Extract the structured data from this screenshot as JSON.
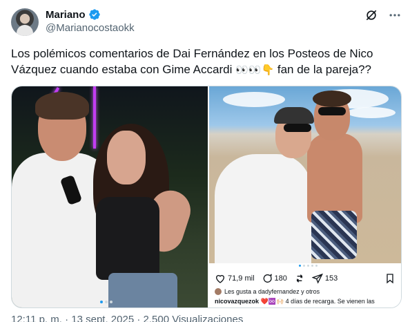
{
  "author": {
    "name": "Mariano",
    "handle": "@Marianocostaokk",
    "verified_icon": "verified-badge-icon"
  },
  "top_actions": {
    "grok_icon": "grok-icon",
    "more_icon": "more-horizontal-icon"
  },
  "tweet": {
    "text": "Los polémicos comentarios de Dai Fernández en los Posteos de Nico Vázquez cuando estaba con Gime Accardi",
    "emojis": "👀👀👇",
    "text_tail": " fan de la pareja??"
  },
  "instagram": {
    "likes_count": "71,9 mil",
    "comments_count": "180",
    "shares_count": "153",
    "liked_by": "Les gusta a dadyfernandez y otros",
    "caption_user": "nicovazquezok",
    "caption_text": "❤️♾️🙌🏻 4 días de recarga. Se vienen las"
  },
  "footer": {
    "meta": "12:11 p. m. · 13 sept. 2025 · 2.500 Visualizaciones"
  },
  "colors": {
    "accent": "#1d9bf0",
    "text": "#0f1419",
    "muted": "#536471",
    "border": "#cfd9de"
  }
}
